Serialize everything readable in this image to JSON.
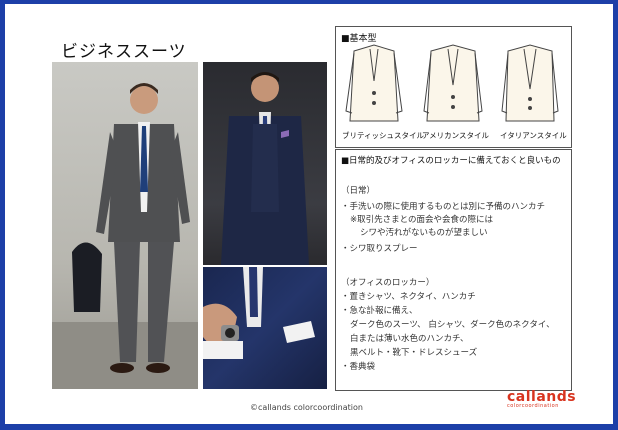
{
  "title": "ビジネススーツ",
  "types_box": {
    "title": "■基本型",
    "labels": [
      "ブリティッシュスタイル",
      "アメリカンスタイル",
      "イタリアンスタイル"
    ]
  },
  "items_box": {
    "title": "■日常的及びオフィスのロッカーに備えておくと良いもの",
    "lines": [
      "（日常）",
      "・手洗いの際に使用するものとは別に予備のハンカチ",
      "※取引先さまとの面会や会食の際には",
      "シワや汚れがないものが望ましい",
      "・シワ取りスプレー",
      "（オフィスのロッカー）",
      "・置きシャツ、ネクタイ、ハンカチ",
      "・急な訃報に備え、",
      "ダーク色のスーツ、 白シャツ、ダーク色のネクタイ、",
      "白または薄い水色のハンカチ、",
      "黒ベルト・靴下・ドレスシューズ",
      "・香典袋"
    ]
  },
  "footer": {
    "copyright": "©callands colorcoordination",
    "logo_main": "callands",
    "logo_sub": "colorcoordination"
  },
  "colors": {
    "frame": "#1d3fa8",
    "logo": "#d8341f"
  }
}
